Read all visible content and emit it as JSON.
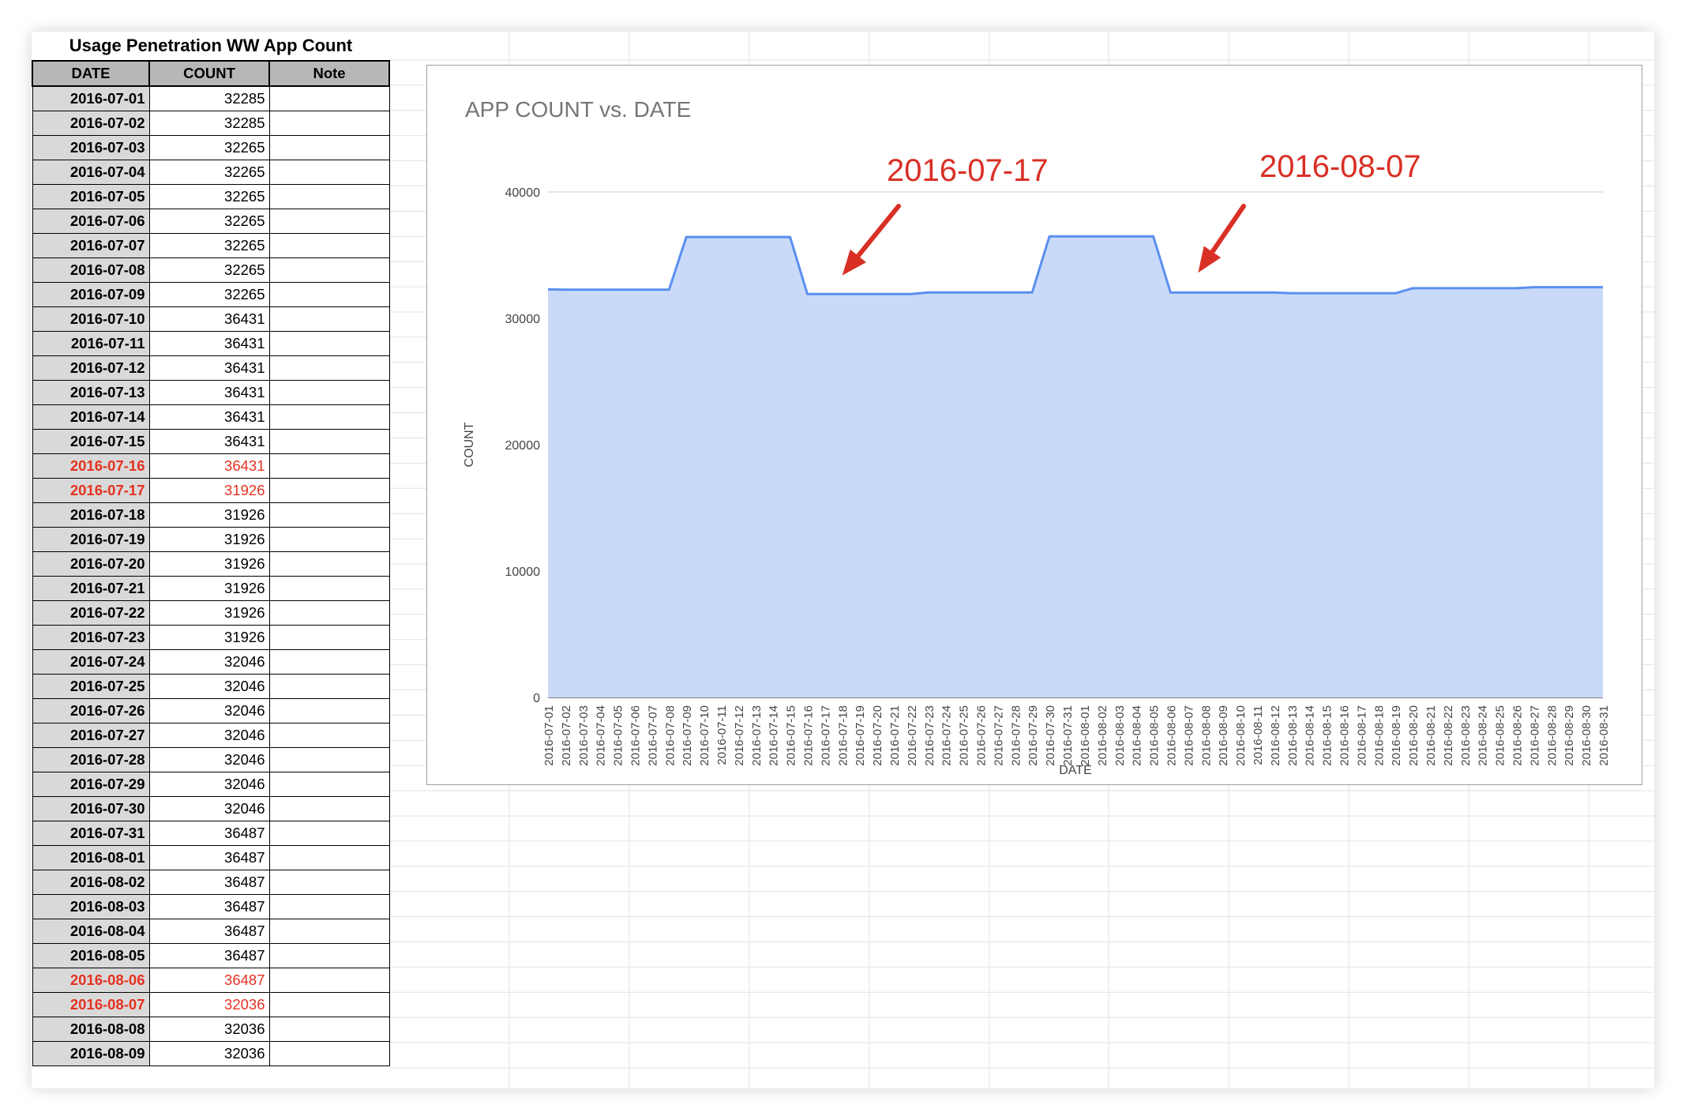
{
  "table": {
    "title": "Usage Penetration WW App Count",
    "headers": [
      "DATE",
      "COUNT",
      "Note"
    ],
    "rows": [
      {
        "date": "2016-07-01",
        "count": "32285"
      },
      {
        "date": "2016-07-02",
        "count": "32285"
      },
      {
        "date": "2016-07-03",
        "count": "32265"
      },
      {
        "date": "2016-07-04",
        "count": "32265"
      },
      {
        "date": "2016-07-05",
        "count": "32265"
      },
      {
        "date": "2016-07-06",
        "count": "32265"
      },
      {
        "date": "2016-07-07",
        "count": "32265"
      },
      {
        "date": "2016-07-08",
        "count": "32265"
      },
      {
        "date": "2016-07-09",
        "count": "32265"
      },
      {
        "date": "2016-07-10",
        "count": "36431"
      },
      {
        "date": "2016-07-11",
        "count": "36431"
      },
      {
        "date": "2016-07-12",
        "count": "36431"
      },
      {
        "date": "2016-07-13",
        "count": "36431"
      },
      {
        "date": "2016-07-14",
        "count": "36431"
      },
      {
        "date": "2016-07-15",
        "count": "36431"
      },
      {
        "date": "2016-07-16",
        "count": "36431",
        "highlight": true
      },
      {
        "date": "2016-07-17",
        "count": "31926",
        "highlight": true
      },
      {
        "date": "2016-07-18",
        "count": "31926"
      },
      {
        "date": "2016-07-19",
        "count": "31926"
      },
      {
        "date": "2016-07-20",
        "count": "31926"
      },
      {
        "date": "2016-07-21",
        "count": "31926"
      },
      {
        "date": "2016-07-22",
        "count": "31926"
      },
      {
        "date": "2016-07-23",
        "count": "31926"
      },
      {
        "date": "2016-07-24",
        "count": "32046"
      },
      {
        "date": "2016-07-25",
        "count": "32046"
      },
      {
        "date": "2016-07-26",
        "count": "32046"
      },
      {
        "date": "2016-07-27",
        "count": "32046"
      },
      {
        "date": "2016-07-28",
        "count": "32046"
      },
      {
        "date": "2016-07-29",
        "count": "32046"
      },
      {
        "date": "2016-07-30",
        "count": "32046"
      },
      {
        "date": "2016-07-31",
        "count": "36487"
      },
      {
        "date": "2016-08-01",
        "count": "36487"
      },
      {
        "date": "2016-08-02",
        "count": "36487"
      },
      {
        "date": "2016-08-03",
        "count": "36487"
      },
      {
        "date": "2016-08-04",
        "count": "36487"
      },
      {
        "date": "2016-08-05",
        "count": "36487"
      },
      {
        "date": "2016-08-06",
        "count": "36487",
        "highlight": true
      },
      {
        "date": "2016-08-07",
        "count": "32036",
        "highlight": true
      },
      {
        "date": "2016-08-08",
        "count": "32036"
      },
      {
        "date": "2016-08-09",
        "count": "32036"
      }
    ],
    "highlight_color": "#e53220"
  },
  "chart_data": {
    "type": "area",
    "title": "APP COUNT vs. DATE",
    "xlabel": "DATE",
    "ylabel": "COUNT",
    "ylim": [
      0,
      40000
    ],
    "yticks": [
      "0",
      "10000",
      "20000",
      "30000",
      "40000"
    ],
    "grid": true,
    "line_color": "#5b8ff0",
    "fill_color": "#c9daf8",
    "x": [
      "2016-07-01",
      "2016-07-02",
      "2016-07-03",
      "2016-07-04",
      "2016-07-05",
      "2016-07-06",
      "2016-07-07",
      "2016-07-08",
      "2016-07-09",
      "2016-07-10",
      "2016-07-11",
      "2016-07-12",
      "2016-07-13",
      "2016-07-14",
      "2016-07-15",
      "2016-07-16",
      "2016-07-17",
      "2016-07-18",
      "2016-07-19",
      "2016-07-20",
      "2016-07-21",
      "2016-07-22",
      "2016-07-23",
      "2016-07-24",
      "2016-07-25",
      "2016-07-26",
      "2016-07-27",
      "2016-07-28",
      "2016-07-29",
      "2016-07-30",
      "2016-07-31",
      "2016-08-01",
      "2016-08-02",
      "2016-08-03",
      "2016-08-04",
      "2016-08-05",
      "2016-08-06",
      "2016-08-07",
      "2016-08-08",
      "2016-08-09",
      "2016-08-10",
      "2016-08-11",
      "2016-08-12",
      "2016-08-13",
      "2016-08-14",
      "2016-08-15",
      "2016-08-16",
      "2016-08-17",
      "2016-08-18",
      "2016-08-19",
      "2016-08-20",
      "2016-08-21",
      "2016-08-22",
      "2016-08-23",
      "2016-08-24",
      "2016-08-25",
      "2016-08-26",
      "2016-08-27",
      "2016-08-28",
      "2016-08-29",
      "2016-08-30",
      "2016-08-31"
    ],
    "series": [
      {
        "values": [
          32285,
          32265,
          32265,
          32265,
          32265,
          32265,
          32265,
          32265,
          36431,
          36431,
          36431,
          36431,
          36431,
          36431,
          36431,
          31926,
          31926,
          31926,
          31926,
          31926,
          31926,
          31926,
          32046,
          32046,
          32046,
          32046,
          32046,
          32046,
          32046,
          36487,
          36487,
          36487,
          36487,
          36487,
          36487,
          36487,
          32036,
          32036,
          32036,
          32036,
          32036,
          32036,
          32036,
          31980,
          31980,
          31980,
          31980,
          31980,
          31980,
          31980,
          32380,
          32380,
          32380,
          32380,
          32380,
          32380,
          32380,
          32460,
          32460,
          32460,
          32460,
          32460
        ]
      }
    ],
    "annotations": [
      {
        "text": "2016-07-17",
        "target_x": "2016-07-17",
        "color": "#d93025"
      },
      {
        "text": "2016-08-07",
        "target_x": "2016-08-07",
        "color": "#d93025"
      }
    ]
  }
}
